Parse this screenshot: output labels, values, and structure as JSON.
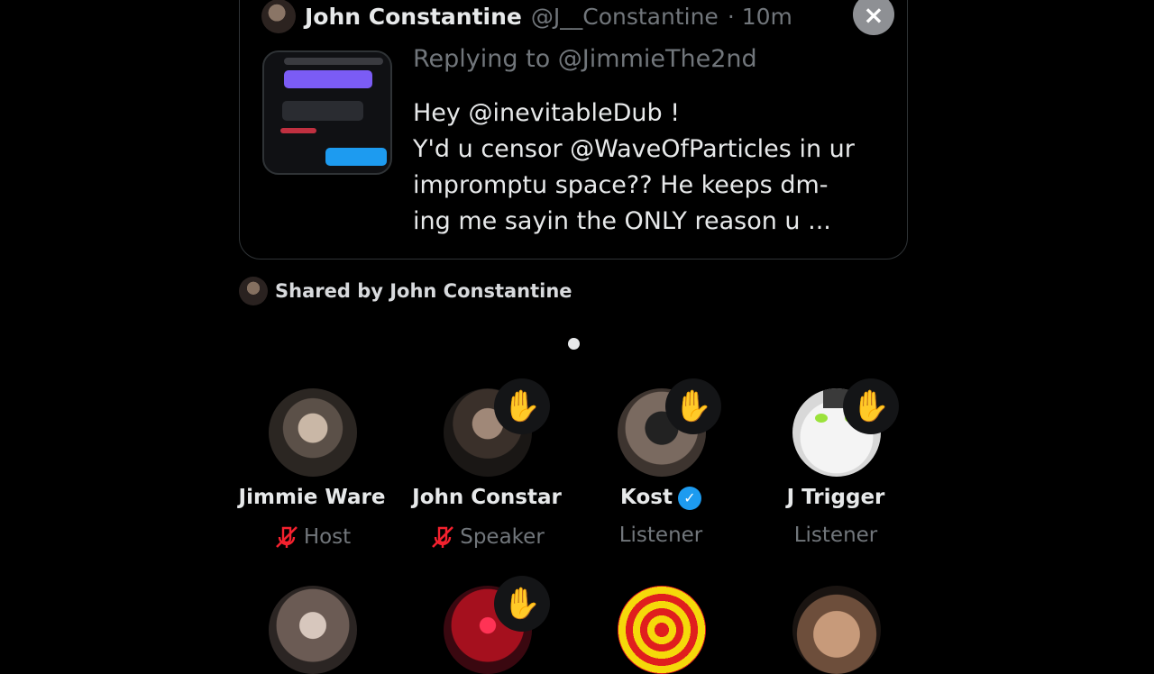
{
  "tweet": {
    "author_name": "John Constantine",
    "author_handle": "@J__Constantine",
    "time": "· 10m",
    "replying_to": "Replying to @JimmieThe2nd",
    "text": "Hey @inevitableDub !\nY'd u censor @WaveOfParticles in ur\nimpromptu space??  He keeps dm-\ning me sayin the ONLY reason u ...",
    "close_icon": "×"
  },
  "shared": {
    "text": "Shared by John Constantine"
  },
  "participants": [
    {
      "name": "Jimmie Ware",
      "role": "Host",
      "muted": true,
      "hand": false
    },
    {
      "name": "John Constar",
      "role": "Speaker",
      "muted": true,
      "hand": true
    },
    {
      "name": "Kost",
      "role": "Listener",
      "verified": true,
      "hand": true
    },
    {
      "name": "J Trigger",
      "role": "Listener",
      "hand": true
    }
  ],
  "icons": {
    "hand": "✋",
    "mic_off": "mic-off-icon",
    "verified": "✓"
  },
  "colors": {
    "accent": "#1d9bf0",
    "muted_red": "#f4212e"
  }
}
